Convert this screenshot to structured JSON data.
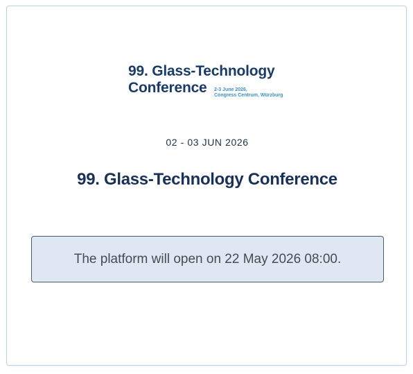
{
  "logo": {
    "line1": "99. Glass-Technology",
    "line2": "Conference",
    "sub_line1": "2-3 June 2026,",
    "sub_line2": "Congress Centrum, Würzburg"
  },
  "event": {
    "date": "02 - 03 JUN 2026",
    "title": "99. Glass-Technology Conference"
  },
  "notice": {
    "text": "The platform will open on 22 May 2026 08:00."
  },
  "colors": {
    "title": "#1a3157",
    "notice_background": "#dfe8f2",
    "card_border": "#b7d3e8",
    "logo_accent": "#3a8fc8"
  }
}
